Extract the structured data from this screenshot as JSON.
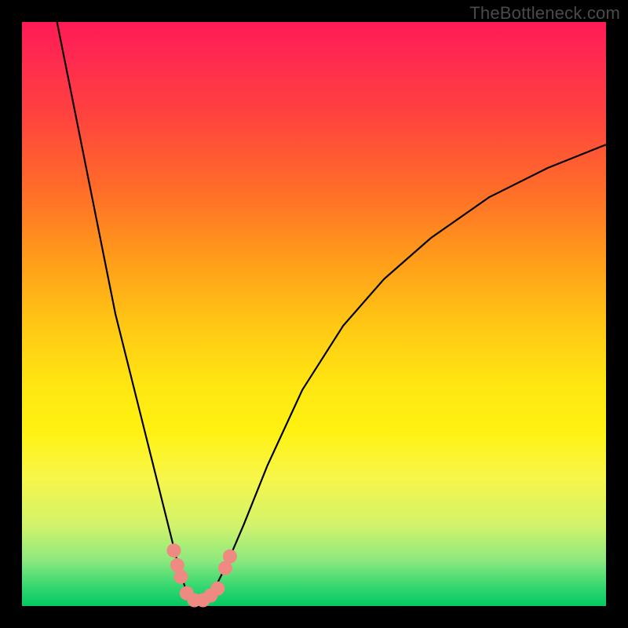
{
  "watermark": "TheBottleneck.com",
  "chart_data": {
    "type": "line",
    "title": "",
    "xlabel": "",
    "ylabel": "",
    "xlim": [
      0,
      100
    ],
    "ylim": [
      0,
      100
    ],
    "series": [
      {
        "name": "curve",
        "color": "#000000",
        "x": [
          6,
          8,
          10,
          12,
          14,
          16,
          18,
          20,
          22,
          24,
          26,
          27,
          28,
          29,
          30,
          31,
          32,
          33,
          35,
          38,
          42,
          48,
          55,
          62,
          70,
          80,
          90,
          100
        ],
        "values": [
          100,
          90,
          80,
          70,
          60,
          50,
          42,
          34,
          26,
          18,
          10,
          6,
          3,
          1,
          0.5,
          0.5,
          1,
          3,
          7,
          14,
          24,
          37,
          48,
          56,
          63,
          70,
          75,
          79
        ]
      }
    ],
    "markers": [
      {
        "name": "left-upper-1",
        "x": 26.0,
        "y": 9.5
      },
      {
        "name": "left-upper-2",
        "x": 26.6,
        "y": 7.0
      },
      {
        "name": "left-upper-3",
        "x": 27.2,
        "y": 5.0
      },
      {
        "name": "bottom-1",
        "x": 28.2,
        "y": 2.2
      },
      {
        "name": "bottom-2",
        "x": 29.5,
        "y": 1.0
      },
      {
        "name": "bottom-3",
        "x": 31.0,
        "y": 1.0
      },
      {
        "name": "bottom-4",
        "x": 32.3,
        "y": 1.8
      },
      {
        "name": "bottom-5",
        "x": 33.5,
        "y": 3.0
      },
      {
        "name": "right-upper-1",
        "x": 34.8,
        "y": 6.5
      },
      {
        "name": "right-upper-2",
        "x": 35.6,
        "y": 8.5
      }
    ],
    "marker_color": "#ef8a82",
    "marker_radius_px": 9,
    "gradient_stops": [
      {
        "pos": 0.0,
        "color": "#ff1a55"
      },
      {
        "pos": 0.5,
        "color": "#ffd814"
      },
      {
        "pos": 0.8,
        "color": "#f7f64a"
      },
      {
        "pos": 1.0,
        "color": "#05c864"
      }
    ]
  }
}
